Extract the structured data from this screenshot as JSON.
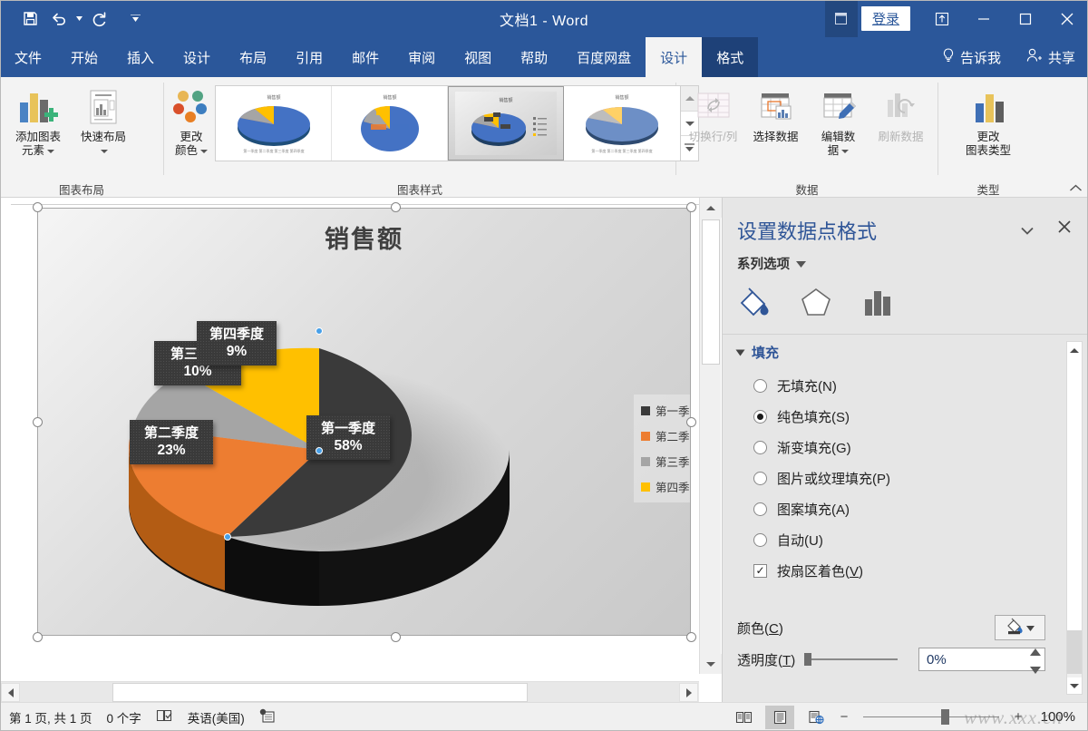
{
  "titlebar": {
    "document_title": "文档1  -  Word",
    "quick_access": [
      {
        "name": "save-icon",
        "label": "保存"
      },
      {
        "name": "undo-icon",
        "label": "撤消"
      },
      {
        "name": "redo-icon",
        "label": "恢复"
      },
      {
        "name": "customize-qat-icon",
        "label": "自定义快速访问工具栏"
      }
    ],
    "signin_label": "登录",
    "ribbon_display_label": "功能区显示选项",
    "minimize_label": "最小化",
    "maximize_label": "最大化",
    "close_label": "关闭"
  },
  "tabs": [
    {
      "label": "文件",
      "state": "normal"
    },
    {
      "label": "开始",
      "state": "normal"
    },
    {
      "label": "插入",
      "state": "normal"
    },
    {
      "label": "设计",
      "state": "normal"
    },
    {
      "label": "布局",
      "state": "normal"
    },
    {
      "label": "引用",
      "state": "normal"
    },
    {
      "label": "邮件",
      "state": "normal"
    },
    {
      "label": "审阅",
      "state": "normal"
    },
    {
      "label": "视图",
      "state": "normal"
    },
    {
      "label": "帮助",
      "state": "normal"
    },
    {
      "label": "百度网盘",
      "state": "normal"
    },
    {
      "label": "设计",
      "state": "active"
    },
    {
      "label": "格式",
      "state": "contextual"
    }
  ],
  "tab_extras": {
    "tell_me": "告诉我",
    "share": "共享"
  },
  "ribbon": {
    "groups": [
      {
        "label": "图表布局",
        "buttons": [
          {
            "label_line1": "添加图表",
            "label_line2": "元素",
            "has_dropdown": true,
            "disabled": false,
            "icon": "add-chart-element-icon"
          },
          {
            "label_line1": "快速布局",
            "label_line2": "",
            "has_dropdown": true,
            "disabled": false,
            "icon": "quick-layout-icon"
          }
        ]
      },
      {
        "label": "图表样式",
        "buttons": [
          {
            "label_line1": "更改",
            "label_line2": "颜色",
            "has_dropdown": true,
            "disabled": false,
            "icon": "change-colors-icon"
          }
        ],
        "gallery": {
          "items": [
            {
              "name": "chart-style-1",
              "title": "销售额",
              "selected": false
            },
            {
              "name": "chart-style-2",
              "title": "销售额",
              "selected": false
            },
            {
              "name": "chart-style-3",
              "title": "销售额",
              "selected": true
            },
            {
              "name": "chart-style-4",
              "title": "销售额",
              "selected": false
            }
          ],
          "scroll_up_label": "上一行",
          "scroll_down_label": "下一行",
          "more_label": "其他"
        }
      },
      {
        "label": "数据",
        "buttons": [
          {
            "label_line1": "切换行/列",
            "label_line2": "",
            "has_dropdown": false,
            "disabled": true,
            "icon": "switch-row-column-icon"
          },
          {
            "label_line1": "选择数据",
            "label_line2": "",
            "has_dropdown": false,
            "disabled": false,
            "icon": "select-data-icon"
          },
          {
            "label_line1": "编辑数",
            "label_line2": "据",
            "has_dropdown": true,
            "disabled": false,
            "icon": "edit-data-icon"
          },
          {
            "label_line1": "刷新数据",
            "label_line2": "",
            "has_dropdown": false,
            "disabled": true,
            "icon": "refresh-data-icon"
          }
        ]
      },
      {
        "label": "类型",
        "buttons": [
          {
            "label_line1": "更改",
            "label_line2": "图表类型",
            "has_dropdown": false,
            "disabled": false,
            "icon": "change-chart-type-icon"
          }
        ]
      }
    ],
    "collapse_label": "折叠功能区"
  },
  "chart_data": {
    "type": "pie",
    "title": "销售额",
    "categories": [
      "第一季度",
      "第二季度",
      "第三季度",
      "第四季度"
    ],
    "values": [
      58,
      23,
      10,
      9
    ],
    "value_labels": [
      "58%",
      "23%",
      "10%",
      "9%"
    ],
    "colors": [
      "#3a3a3a",
      "#ed7d31",
      "#a5a5a5",
      "#ffc000"
    ],
    "selected_slice": "第一季度",
    "legend": {
      "position": "right",
      "entries": [
        "第一季度",
        "第二季度",
        "第三季度",
        "第四季度"
      ]
    },
    "data_labels": [
      {
        "category": "第一季度",
        "pct": "58%"
      },
      {
        "category": "第二季度",
        "pct": "23%"
      },
      {
        "category": "第三季度",
        "pct": "10%"
      },
      {
        "category": "第四季度",
        "pct": "9%"
      }
    ],
    "three_d": true,
    "grid": false,
    "xlabel": "",
    "ylabel": ""
  },
  "taskpane": {
    "title": "设置数据点格式",
    "dropdown_label": "任务窗格选项",
    "close_label": "关闭",
    "subtitle": "系列选项",
    "icon_tabs": [
      {
        "name": "fill-and-line-icon",
        "label": "填充与线条",
        "selected": true
      },
      {
        "name": "effects-icon",
        "label": "效果",
        "selected": false
      },
      {
        "name": "series-options-icon",
        "label": "系列选项",
        "selected": false
      }
    ],
    "section_title": "填充",
    "options": [
      {
        "label": "无填充(N)",
        "text": "无填充",
        "key": "N",
        "selected": false
      },
      {
        "label": "纯色填充(S)",
        "text": "纯色填充",
        "key": "S",
        "selected": true
      },
      {
        "label": "渐变填充(G)",
        "text": "渐变填充",
        "key": "G",
        "selected": false
      },
      {
        "label": "图片或纹理填充(P)",
        "text": "图片或纹理填充",
        "key": "P",
        "selected": false
      },
      {
        "label": "图案填充(A)",
        "text": "图案填充",
        "key": "A",
        "selected": false
      },
      {
        "label": "自动(U)",
        "text": "自动",
        "key": "U",
        "selected": false
      }
    ],
    "checkbox": {
      "text": "按扇区着色",
      "key": "V",
      "checked": true,
      "mark": "✓"
    },
    "color_row": {
      "text": "颜色",
      "key": "C",
      "swatch_hex": "#3a3a3a"
    },
    "transparency_row": {
      "text": "透明度",
      "key": "T",
      "value": "0%"
    }
  },
  "statusbar": {
    "page_info": "第 1 页, 共 1 页",
    "word_count": "0 个字",
    "proofing_icon_label": "校对",
    "language": "英语(美国)",
    "macro_icon_label": "宏录制",
    "views": [
      {
        "name": "read-mode-view",
        "label": "阅读视图",
        "active": false
      },
      {
        "name": "print-layout-view",
        "label": "页面视图",
        "active": true
      },
      {
        "name": "web-layout-view",
        "label": "Web 版式视图",
        "active": false
      }
    ],
    "zoom_out_label": "缩小",
    "zoom_in_label": "放大",
    "zoom_level": "100%",
    "watermark": "www.xxx.cn"
  }
}
